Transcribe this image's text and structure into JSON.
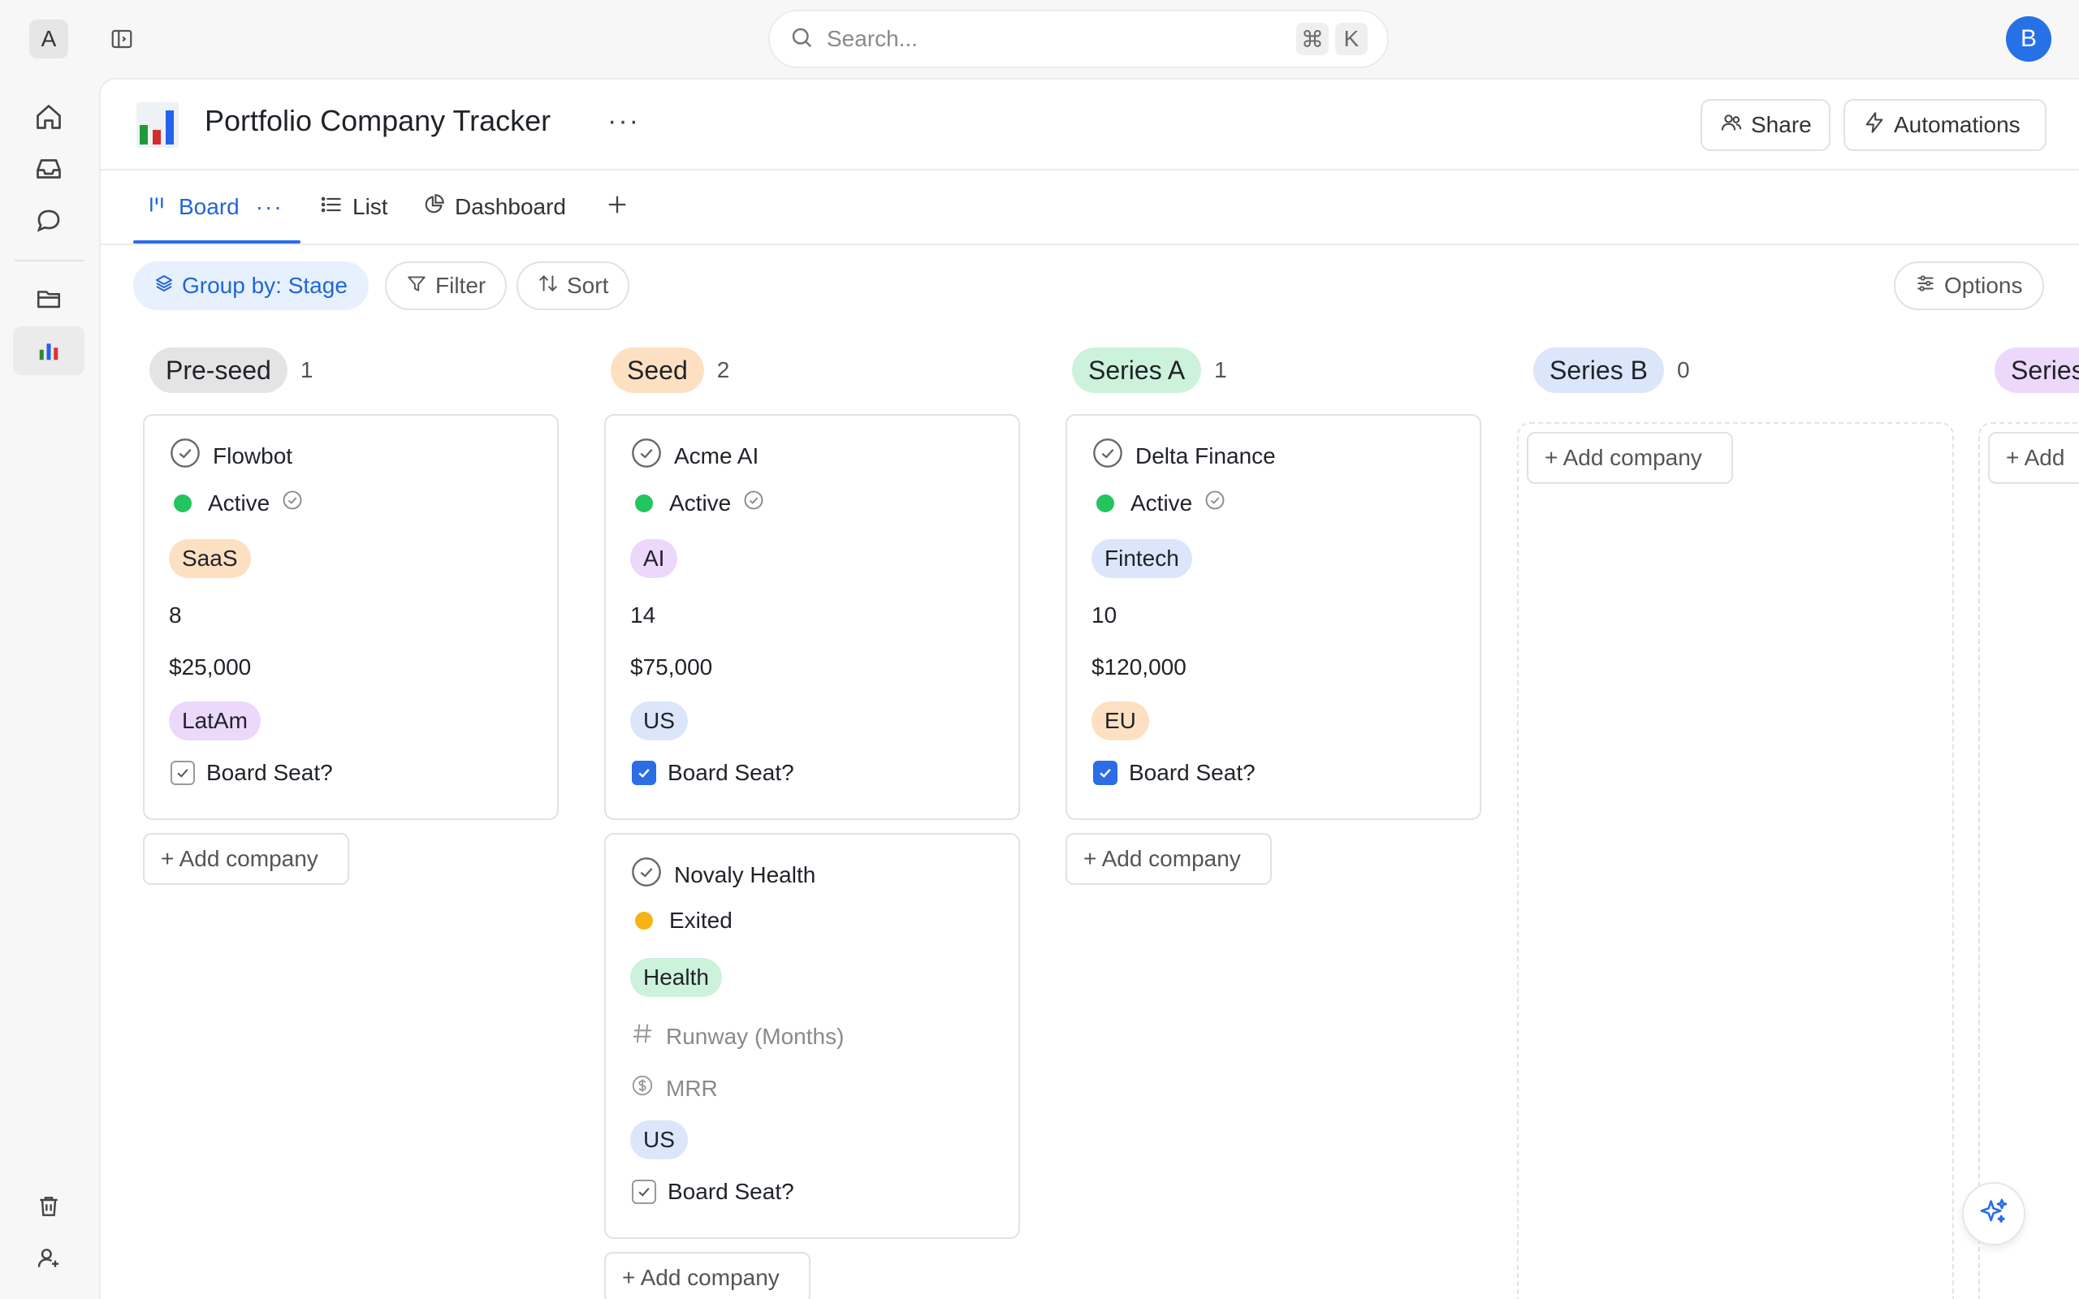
{
  "workspace": {
    "initial": "A"
  },
  "search": {
    "placeholder": "Search...",
    "shortcut_mod": "⌘",
    "shortcut_key": "K"
  },
  "user": {
    "initial": "B"
  },
  "page": {
    "title": "Portfolio Company Tracker",
    "more": "···"
  },
  "header_buttons": {
    "share": "Share",
    "automations": "Automations"
  },
  "tabs": [
    {
      "label": "Board",
      "more": "···"
    },
    {
      "label": "List"
    },
    {
      "label": "Dashboard"
    }
  ],
  "toolbar": {
    "group_by": "Group by: Stage",
    "filter": "Filter",
    "sort": "Sort",
    "options": "Options"
  },
  "columns": [
    {
      "stage": "Pre-seed",
      "count": "1",
      "color": "#e4e4e4",
      "cards": [
        {
          "name": "Flowbot",
          "status": "Active",
          "status_color": "#22c55e",
          "industry": "SaaS",
          "industry_color": "#fde0c2",
          "runway": "8",
          "mrr": "$25,000",
          "region": "LatAm",
          "region_color": "#ecd8fb",
          "board_seat": "Board Seat?",
          "board_seat_checked": false
        }
      ],
      "add_label": "+ Add company"
    },
    {
      "stage": "Seed",
      "count": "2",
      "color": "#fde0c2",
      "cards": [
        {
          "name": "Acme AI",
          "status": "Active",
          "status_color": "#22c55e",
          "industry": "AI",
          "industry_color": "#ecd8fb",
          "runway": "14",
          "mrr": "$75,000",
          "region": "US",
          "region_color": "#dbe6fb",
          "board_seat": "Board Seat?",
          "board_seat_checked": true
        },
        {
          "name": "Novaly Health",
          "status": "Exited",
          "status_color": "#f5b316",
          "industry": "Health",
          "industry_color": "#cdf2dc",
          "runway_placeholder": "Runway (Months)",
          "mrr_placeholder": "MRR",
          "region": "US",
          "region_color": "#dbe6fb",
          "board_seat": "Board Seat?",
          "board_seat_checked": false
        }
      ],
      "add_label": "+ Add company"
    },
    {
      "stage": "Series A",
      "count": "1",
      "color": "#cdf2dc",
      "cards": [
        {
          "name": "Delta Finance",
          "status": "Active",
          "status_color": "#22c55e",
          "industry": "Fintech",
          "industry_color": "#dbe6fb",
          "runway": "10",
          "mrr": "$120,000",
          "region": "EU",
          "region_color": "#fde0c2",
          "board_seat": "Board Seat?",
          "board_seat_checked": true
        }
      ],
      "add_label": "+ Add company"
    },
    {
      "stage": "Series B",
      "count": "0",
      "color": "#dbe6fb",
      "add_label": "+ Add company"
    },
    {
      "stage": "Series",
      "color": "#ecd8fb",
      "add_label": "+ Add"
    }
  ],
  "icons": [
    "home-icon",
    "inbox-icon",
    "chat-icon",
    "folder-icon",
    "chart-icon",
    "trash-icon",
    "user-add-icon",
    "search-icon",
    "sidebar-toggle-icon",
    "share-icon",
    "lightning-icon",
    "board-icon",
    "list-icon",
    "dashboard-icon",
    "plus-icon",
    "layers-icon",
    "filter-icon",
    "sort-icon",
    "options-icon",
    "sparkle-icon"
  ]
}
